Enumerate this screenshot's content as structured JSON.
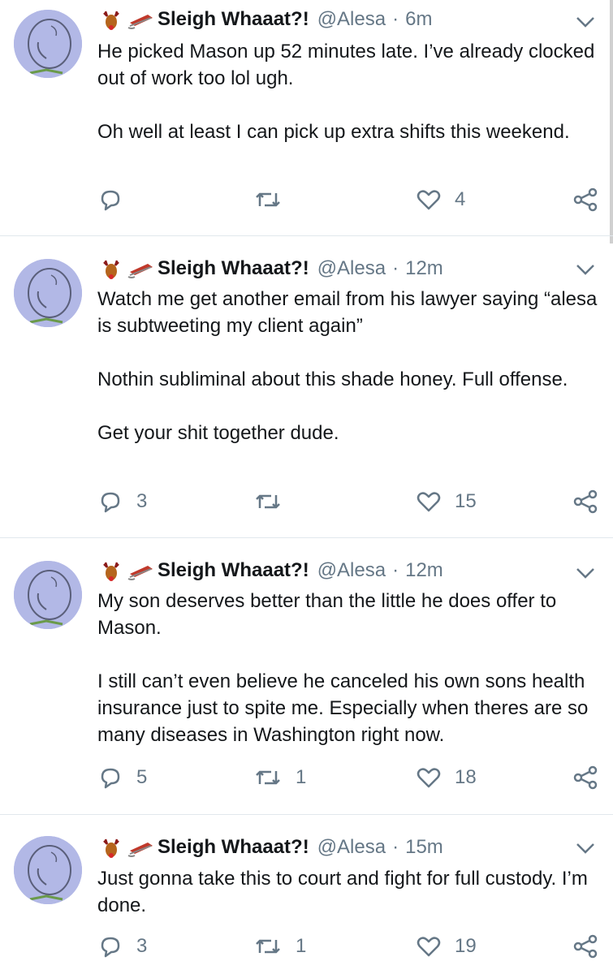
{
  "tweets": [
    {
      "display_name": "Sleigh Whaaat?!",
      "handle": "@Alesa",
      "separator": "·",
      "time": "6m",
      "text": "He picked Mason up 52 minutes late. I’ve already clocked out of work too lol ugh.\n\nOh well at least I can pick up extra shifts this weekend.",
      "reply_count": "",
      "retweet_count": "",
      "like_count": "4"
    },
    {
      "display_name": "Sleigh Whaaat?!",
      "handle": "@Alesa",
      "separator": "·",
      "time": "12m",
      "text": "Watch me get another email from his lawyer saying “alesa is subtweeting my client again”\n\nNothin subliminal about this shade honey. Full offense.\n\nGet your shit together dude.",
      "reply_count": "3",
      "retweet_count": "",
      "like_count": "15"
    },
    {
      "display_name": "Sleigh Whaaat?!",
      "handle": "@Alesa",
      "separator": "·",
      "time": "12m",
      "text": "My son deserves better than the little he does offer to Mason.\n\nI still can’t even believe he canceled his own sons health insurance just to spite me. Especially when theres are so many diseases in Washington right now.",
      "reply_count": "5",
      "retweet_count": "1",
      "like_count": "18"
    },
    {
      "display_name": "Sleigh Whaaat?!",
      "handle": "@Alesa",
      "separator": "·",
      "time": "15m",
      "text": "Just gonna take this to court and fight for full custody. I’m done.",
      "reply_count": "3",
      "retweet_count": "1",
      "like_count": "19"
    }
  ],
  "icons": {
    "avatar": "avatar-doodle-icon",
    "emoji_reindeer": "reindeer-emoji-icon",
    "emoji_sled": "sled-emoji-icon",
    "chevron": "chevron-down-icon",
    "reply": "reply-icon",
    "retweet": "retweet-icon",
    "like": "heart-icon",
    "share": "share-icon"
  },
  "colors": {
    "text": "#14171a",
    "muted": "#657786",
    "divider": "#e1e8ed",
    "avatar_bg": "#b2b8e6"
  }
}
